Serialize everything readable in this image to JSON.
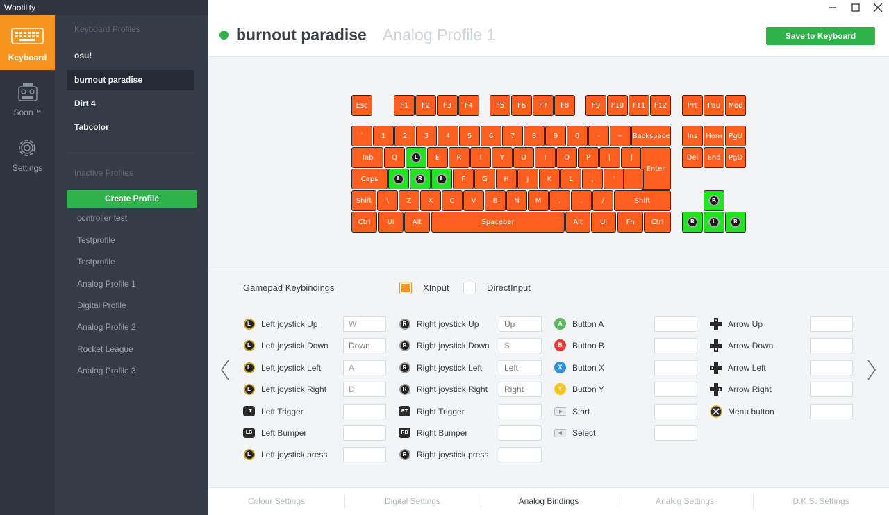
{
  "app": {
    "title": "Wootility"
  },
  "rail": [
    {
      "label": "Keyboard",
      "icon": "keyboard-icon",
      "active": true
    },
    {
      "label": "Soon™",
      "icon": "controller-icon",
      "active": false
    },
    {
      "label": "Settings",
      "icon": "gear-icon",
      "active": false
    }
  ],
  "sidebar": {
    "keyboard_profiles_title": "Keyboard Profiles",
    "profiles": [
      "osu!",
      "burnout paradise",
      "Dirt 4",
      "Tabcolor"
    ],
    "inactive_title": "Inactive Profiles",
    "create_label": "Create Profile",
    "inactive": [
      "controller test",
      "Testprofile",
      "Testprofile",
      "Analog Profile 1",
      "Digital Profile",
      "Analog Profile 2",
      "Rocket League",
      "Analog Profile 3"
    ]
  },
  "header": {
    "title": "burnout paradise",
    "subtitle": "Analog Profile 1",
    "save_label": "Save to Keyboard",
    "status_color": "#2eb34b"
  },
  "colors": {
    "accent": "#f7941d",
    "key": "#ff5e1f",
    "key_bound": "#1ee61e",
    "green_button": "#2eb34b"
  },
  "keyboard": {
    "fn_row": [
      "Esc",
      "F1",
      "F2",
      "F3",
      "F4",
      "F5",
      "F6",
      "F7",
      "F8",
      "F9",
      "F10",
      "F11",
      "F12",
      "Prt",
      "Pau",
      "Mod"
    ],
    "num_row": [
      "`",
      "1",
      "2",
      "3",
      "4",
      "5",
      "6",
      "7",
      "8",
      "9",
      "0",
      "-",
      "=",
      "Backspace",
      "Ins",
      "Hom",
      "PgU"
    ],
    "tab_row": [
      "Tab",
      "Q",
      "L",
      "E",
      "R",
      "T",
      "Y",
      "U",
      "I",
      "O",
      "P",
      "[",
      "]",
      "Enter",
      "Del",
      "End",
      "PgD"
    ],
    "caps_row": [
      "Caps",
      "L",
      "R",
      "L",
      "F",
      "G",
      "H",
      "J",
      "K",
      "L",
      ";",
      "'",
      ""
    ],
    "shift_row": [
      "Shift",
      "\\",
      "Z",
      "X",
      "C",
      "V",
      "B",
      "N",
      "M",
      ",",
      ".",
      "/",
      "Shift",
      "R"
    ],
    "ctrl_row": [
      "Ctrl",
      "Ui",
      "Alt",
      "Spacebar",
      "Alt",
      "Ui",
      "Fn",
      "Ctrl",
      "R",
      "L",
      "R"
    ]
  },
  "bindings": {
    "title": "Gamepad Keybindings",
    "modes": [
      {
        "label": "XInput",
        "selected": true
      },
      {
        "label": "DirectInput",
        "selected": false
      }
    ],
    "col1": [
      {
        "label": "Left joystick Up",
        "icon": "left-stick-icon",
        "glyph": "L",
        "value": "W",
        "placeholder": ""
      },
      {
        "label": "Left joystick Down",
        "icon": "left-stick-icon",
        "glyph": "L",
        "value": "",
        "placeholder": "Down"
      },
      {
        "label": "Left joystick Left",
        "icon": "left-stick-icon",
        "glyph": "L",
        "value": "A",
        "placeholder": ""
      },
      {
        "label": "Left joystick Right",
        "icon": "left-stick-icon",
        "glyph": "L",
        "value": "D",
        "placeholder": ""
      },
      {
        "label": "Left Trigger",
        "icon": "left-trigger-icon",
        "glyph": "LT",
        "value": "",
        "placeholder": ""
      },
      {
        "label": "Left Bumper",
        "icon": "left-bumper-icon",
        "glyph": "LB",
        "value": "",
        "placeholder": ""
      },
      {
        "label": "Left joystick press",
        "icon": "left-stick-icon",
        "glyph": "L",
        "value": "",
        "placeholder": ""
      }
    ],
    "col2": [
      {
        "label": "Right joystick Up",
        "icon": "right-stick-icon",
        "glyph": "R",
        "value": "",
        "placeholder": "Up"
      },
      {
        "label": "Right joystick Down",
        "icon": "right-stick-icon",
        "glyph": "R",
        "value": "S",
        "placeholder": ""
      },
      {
        "label": "Right joystick Left",
        "icon": "right-stick-icon",
        "glyph": "R",
        "value": "",
        "placeholder": "Left"
      },
      {
        "label": "Right joystick Right",
        "icon": "right-stick-icon",
        "glyph": "R",
        "value": "",
        "placeholder": "Right"
      },
      {
        "label": "Right Trigger",
        "icon": "right-trigger-icon",
        "glyph": "RT",
        "value": "",
        "placeholder": ""
      },
      {
        "label": "Right Bumper",
        "icon": "right-bumper-icon",
        "glyph": "RB",
        "value": "",
        "placeholder": ""
      },
      {
        "label": "Right joystick press",
        "icon": "right-stick-icon",
        "glyph": "R",
        "value": "",
        "placeholder": ""
      }
    ],
    "col3": [
      {
        "label": "Button A",
        "icon": "button-a-icon",
        "glyph": "A",
        "color": "#5cb85c"
      },
      {
        "label": "Button B",
        "icon": "button-b-icon",
        "glyph": "B",
        "color": "#e03c31"
      },
      {
        "label": "Button X",
        "icon": "button-x-icon",
        "glyph": "X",
        "color": "#2d8fe0"
      },
      {
        "label": "Button Y",
        "icon": "button-y-icon",
        "glyph": "Y",
        "color": "#f5c518"
      },
      {
        "label": "Start",
        "icon": "start-icon",
        "glyph": "▷",
        "color": ""
      },
      {
        "label": "Select",
        "icon": "select-icon",
        "glyph": "◁",
        "color": ""
      }
    ],
    "col4": [
      {
        "label": "Arrow Up",
        "icon": "dpad-up-icon"
      },
      {
        "label": "Arrow Down",
        "icon": "dpad-down-icon"
      },
      {
        "label": "Arrow Left",
        "icon": "dpad-left-icon"
      },
      {
        "label": "Arrow Right",
        "icon": "dpad-right-icon"
      },
      {
        "label": "Menu button",
        "icon": "xbox-menu-icon"
      }
    ]
  },
  "tabs": [
    {
      "label": "Colour Settings",
      "active": false
    },
    {
      "label": "Digital Settings",
      "active": false
    },
    {
      "label": "Analog Bindings",
      "active": true
    },
    {
      "label": "Analog Settings",
      "active": false
    },
    {
      "label": "D.K.S. Settings",
      "active": false
    }
  ]
}
